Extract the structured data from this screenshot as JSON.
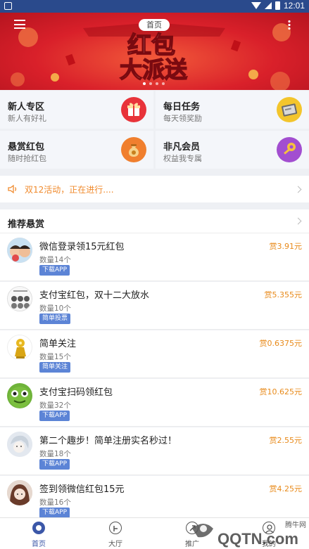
{
  "status_bar": {
    "time": "12:01"
  },
  "banner": {
    "page_tab": "首页",
    "art_line1": "红包",
    "art_line2": "大派送",
    "active_dot": 0,
    "dot_count": 4
  },
  "grid": [
    {
      "title": "新人专区",
      "subtitle": "新人有好礼",
      "icon": "gift-icon",
      "color": "#e8333a"
    },
    {
      "title": "每日任务",
      "subtitle": "每天领奖励",
      "icon": "task-card-icon",
      "color": "#f3c52c"
    },
    {
      "title": "悬赏红包",
      "subtitle": "随时抢红包",
      "icon": "money-bag-icon",
      "color": "#f07f2e"
    },
    {
      "title": "非凡会员",
      "subtitle": "权益我专属",
      "icon": "vip-icon",
      "color": "#a24ed0"
    }
  ],
  "notice": {
    "text": "双12活动，正在进行...."
  },
  "recommend": {
    "title": "推荐悬赏",
    "items": [
      {
        "title": "微信登录领15元红包",
        "count": "数量14个",
        "tag": "下载APP",
        "reward": "赏3.91元",
        "avatar": "kids-photo"
      },
      {
        "title": "支付宝红包，双十二大放水",
        "count": "数量10个",
        "tag": "简单投票",
        "reward": "赏5.355元",
        "avatar": "poster-photo"
      },
      {
        "title": "简单关注",
        "count": "数量15个",
        "tag": "简单关注",
        "reward": "赏0.6375元",
        "avatar": "gold-figure"
      },
      {
        "title": "支付宝扫码领红包",
        "count": "数量32个",
        "tag": "下载APP",
        "reward": "赏10.625元",
        "avatar": "frog-face"
      },
      {
        "title": "第二个趣步！简单注册实名秒过！",
        "count": "数量18个",
        "tag": "下载APP",
        "reward": "赏2.55元",
        "avatar": "anime-boy"
      },
      {
        "title": "签到领微信红包15元",
        "count": "数量16个",
        "tag": "下载APP",
        "reward": "赏4.25元",
        "avatar": "anime-girl"
      }
    ]
  },
  "tabbar": [
    {
      "label": "首页",
      "icon": "home-icon",
      "active": true
    },
    {
      "label": "大厅",
      "icon": "hall-icon",
      "active": false
    },
    {
      "label": "推广",
      "icon": "share-icon",
      "active": false
    },
    {
      "label": "我的",
      "icon": "user-icon",
      "active": false
    }
  ],
  "watermark": {
    "text": "QQTN.com",
    "sub": "腾牛网"
  },
  "colors": {
    "accent": "#2a4a8c",
    "reward": "#e88a1a",
    "tag": "#5c84d6",
    "banner_red": "#d9202a"
  }
}
